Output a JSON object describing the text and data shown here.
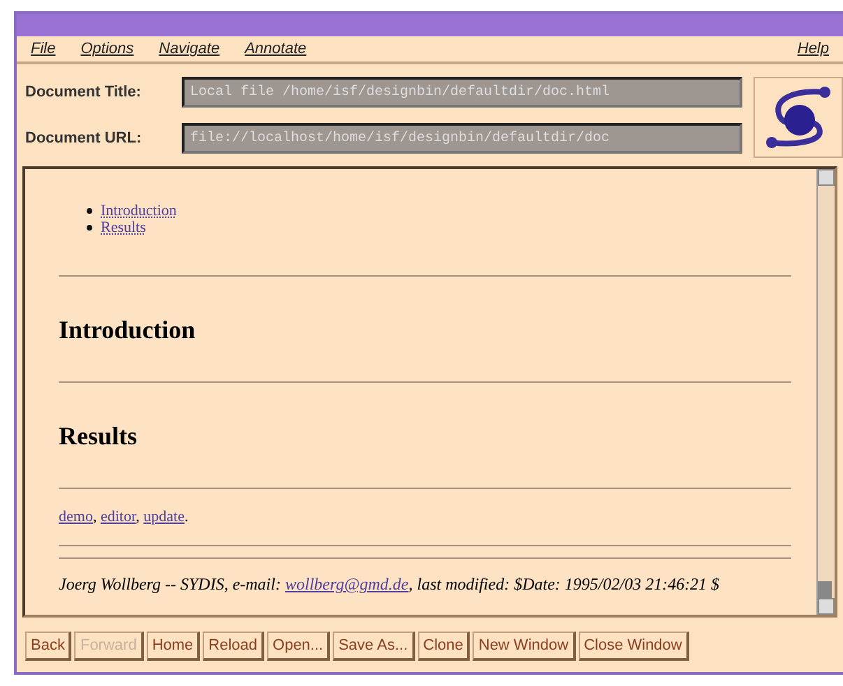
{
  "menu": [
    "File",
    "Options",
    "Navigate",
    "Annotate"
  ],
  "help_menu": "Help",
  "fields": [
    {
      "label": "Document Title:",
      "value": "Local file /home/isf/designbin/defaultdir/doc.html"
    },
    {
      "label": "Document URL:",
      "value": "file://localhost/home/isf/designbin/defaultdir/doc"
    }
  ],
  "document": {
    "toc": [
      "Introduction",
      "Results"
    ],
    "sections": [
      "Introduction",
      "Results"
    ],
    "links": [
      {
        "label": "demo",
        "separator": ","
      },
      {
        "label": "editor",
        "separator": ","
      },
      {
        "label": "update",
        "separator": "."
      }
    ],
    "footer": {
      "before": "Joerg Wollberg -- SYDIS, e-mail: ",
      "email": "wollberg@gmd.de",
      "after": ", last modified: $Date: 1995/02/03 21:46:21 $"
    }
  },
  "buttons": [
    {
      "label": "Back",
      "disabled": false
    },
    {
      "label": "Forward",
      "disabled": true
    },
    {
      "label": "Home",
      "disabled": false
    },
    {
      "label": "Reload",
      "disabled": false
    },
    {
      "label": "Open...",
      "disabled": false
    },
    {
      "label": "Save As...",
      "disabled": false
    },
    {
      "label": "Clone",
      "disabled": false
    },
    {
      "label": "New Window",
      "disabled": false
    },
    {
      "label": "Close Window",
      "disabled": false
    }
  ]
}
